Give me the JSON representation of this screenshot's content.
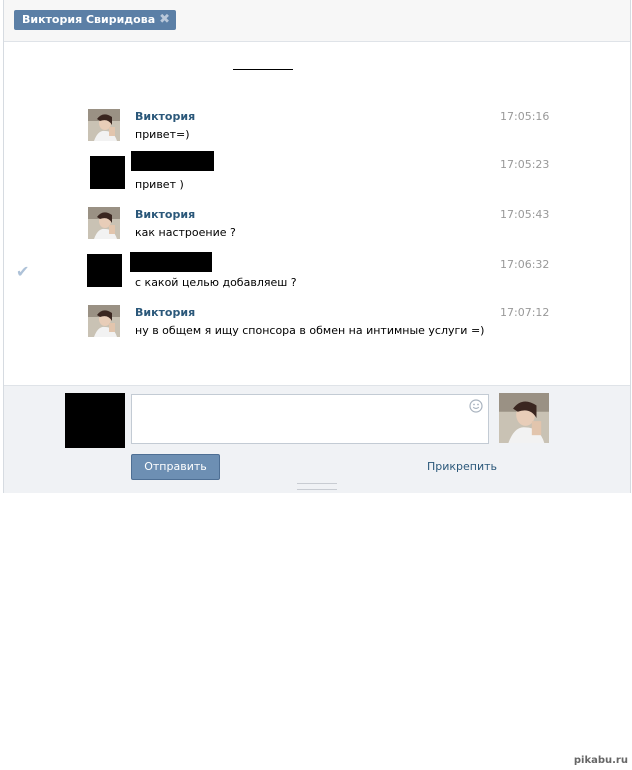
{
  "tab": {
    "title": "Виктория Свиридова",
    "close_glyph": "✖"
  },
  "messages": [
    {
      "author": "Виктория",
      "text": "привет=)",
      "time": "17:05:16",
      "mine": false
    },
    {
      "author": "",
      "text": "привет )",
      "time": "17:05:23",
      "mine": true
    },
    {
      "author": "Виктория",
      "text": "как настроение ?",
      "time": "17:05:43",
      "mine": false
    },
    {
      "author": "",
      "text": "с какой целью добавляеш ?",
      "time": "17:06:32",
      "mine": true,
      "read_icon": "✔"
    },
    {
      "author": "Виктория",
      "text": "ну в общем я ищу спонсора в обмен на интимные услуги =)",
      "time": "17:07:12",
      "mine": false
    }
  ],
  "composer": {
    "send_label": "Отправить",
    "attach_label": "Прикрепить",
    "message_value": ""
  },
  "watermark": "pikabu.ru",
  "colors": {
    "accent": "#5b7fa6",
    "link": "#2b587a",
    "time": "#999999"
  }
}
